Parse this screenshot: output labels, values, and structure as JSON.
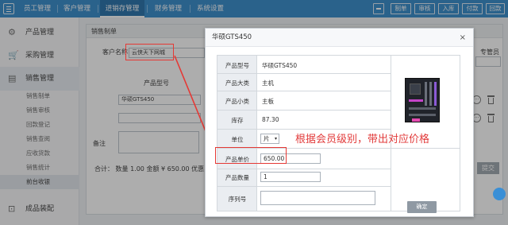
{
  "nav": {
    "items": [
      "员工管理",
      "客户管理",
      "进销存管理",
      "财务管理",
      "系统设置"
    ],
    "active_index": 2,
    "toolbar": [
      "制单",
      "审核",
      "入库",
      "付款",
      "回款"
    ]
  },
  "sidebar": {
    "groups": [
      {
        "label": "产品管理",
        "icon": "gear-icon"
      },
      {
        "label": "采购管理",
        "icon": "cart-icon"
      },
      {
        "label": "销售管理",
        "icon": "chart-icon"
      },
      {
        "label": "成品装配",
        "icon": "box-icon"
      }
    ],
    "sub_items": [
      "销售制单",
      "销售审核",
      "回款登记",
      "销售查阅",
      "应收货款",
      "销售统计",
      "前台收银"
    ],
    "selected_sub_index": 6
  },
  "form": {
    "panel_title": "销售制单",
    "customer_label": "客户名称",
    "customer_value": "云侠天下网城",
    "salesperson_label": "专管员",
    "product_model_header": "产品型号",
    "row1_model": "华硕GTS450",
    "remark_label": "备注",
    "summary": "合计： 数量 1.00   金额 ¥ 650.00   优惠",
    "submit_label": "提交"
  },
  "modal": {
    "title": "华硕GTS450",
    "close": "×",
    "fields": [
      {
        "label": "产品型号",
        "value": "华硕GTS450"
      },
      {
        "label": "产品大类",
        "value": "主机"
      },
      {
        "label": "产品小类",
        "value": "主板"
      },
      {
        "label": "库存",
        "value": "87.30"
      },
      {
        "label": "单位",
        "value": "片"
      },
      {
        "label": "产品单价",
        "value": "650.00"
      },
      {
        "label": "产品数量",
        "value": "1"
      },
      {
        "label": "序列号",
        "value": ""
      }
    ],
    "confirm_label": "确定"
  },
  "annotation": "根据会员级别，带出对应价格",
  "colors": {
    "topbar": "#2d86c9",
    "annotation": "#e23b3b",
    "highlight": "#e53935"
  }
}
